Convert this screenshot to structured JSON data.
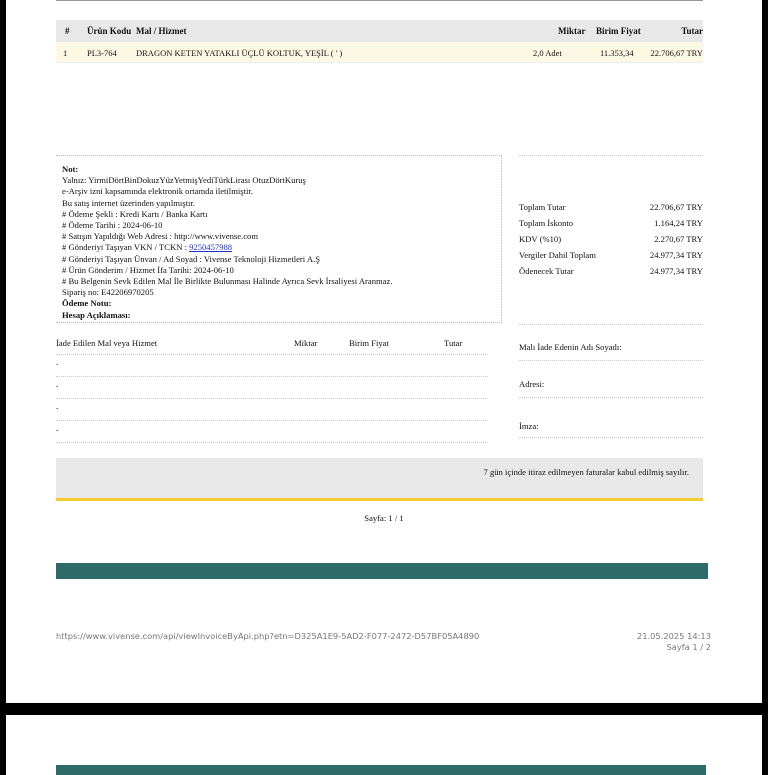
{
  "table": {
    "headers": {
      "no": "#",
      "code": "Ürün Kodu",
      "desc": "Mal / Hizmet",
      "qty": "Miktar",
      "price": "Birim Fiyat",
      "total": "Tutar"
    },
    "rows": [
      {
        "no": "1",
        "code": "PL3-764",
        "desc": "DRAGON KETEN YATAKLI ÜÇLÜ KOLTUK, YEŞİL  ( ' )",
        "qty": "2,0 Adet",
        "price": "11.353,34",
        "total": "22.706,67 TRY"
      }
    ]
  },
  "notes": {
    "title": "Not:",
    "lines": [
      "Yalnız: YirmiDörtBinDokuzYüzYetmişYediTürkLirası OtuzDörtKuruş",
      "e-Arşiv izni kapsamında elektronik ortamda iletilmiştir.",
      "Bu satış internet üzerinden yapılmıştır.",
      "# Ödeme Şekli : Kredi Kartı / Banka Kartı",
      "# Ödeme Tarihi : 2024-06-10",
      "# Satışın Yapıldığı Web Adresi : http://www.vivense.com"
    ],
    "carrier_vkn_label": "# Gönderiyi Taşıyan VKN / TCKN : ",
    "carrier_vkn": "9250457988",
    "lines2": [
      "# Gönderiyi Taşıyan Ünvan / Ad Soyad : Vivense Teknoloji Hizmetleri A.Ş",
      "# Ürün Gönderim / Hizmet İfa Tarihi: 2024-06-10",
      "# Bu Belgenin Sevk Edilen Mal İle Birlikte Bulunması Halinde Ayrıca Sevk İrsaliyesi Aranmaz.",
      "Sipariş no: E42206970205"
    ],
    "payment_note": "Ödeme Notu:",
    "account_desc": "Hesap Açıklaması:"
  },
  "totals": [
    {
      "label": "Toplam Tutar",
      "value": "22.706,67 TRY"
    },
    {
      "label": "Toplam İskonto",
      "value": "1.164,24 TRY"
    },
    {
      "label": "KDV (%10)",
      "value": "2.270,67 TRY"
    },
    {
      "label": "Vergiler Dahil Toplam",
      "value": "24.977,34 TRY"
    },
    {
      "label": "Ödenecek Tutar",
      "value": "24.977,34 TRY"
    }
  ],
  "returns": {
    "headers": {
      "item": "İade Edilen Mal veya Hizmet",
      "qty": "Miktar",
      "price": "Birim Fiyat",
      "total": "Tutar"
    },
    "rows": [
      ".",
      ".",
      ".",
      "."
    ]
  },
  "return_sign": {
    "name_label": "Malı İade Edenin Adı Soyadı:",
    "address_label": "Adresi:",
    "signature_label": "İmza:"
  },
  "notice": "7 gün içinde itiraz edilmeyen faturalar kabul edilmiş sayılır.",
  "page_number": "Sayfa: 1 / 1",
  "footer": {
    "url": "https://www.vivense.com/api/viewInvoiceByApi.php?etn=D325A1E9-5AD2-F077-2472-D57BF05A4890",
    "datetime": "21.05.2025 14:13",
    "print_page": "Sayfa 1 / 2"
  }
}
